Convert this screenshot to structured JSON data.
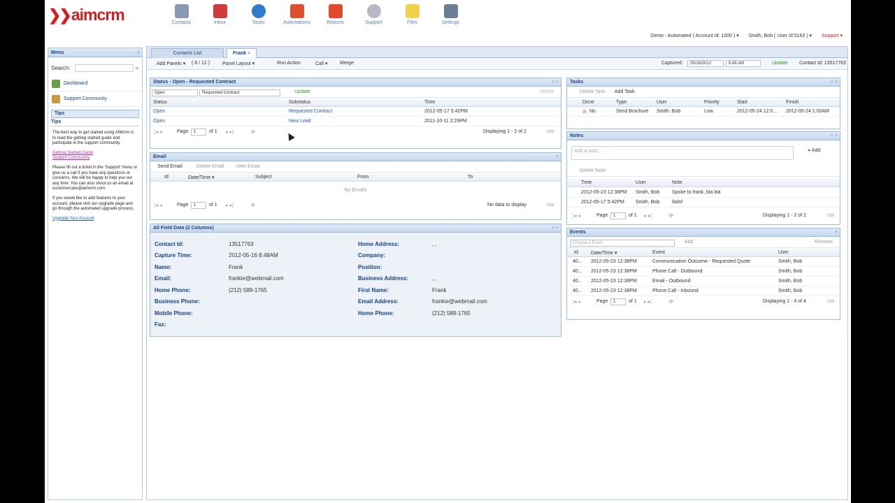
{
  "logo": {
    "mark": "❯❯",
    "text": "aimcrm"
  },
  "topnav": [
    {
      "label": "Contacts",
      "color": "#8a99b0"
    },
    {
      "label": "Inbox",
      "color": "#d33b3b"
    },
    {
      "label": "Tasks",
      "color": "#2f7cc8"
    },
    {
      "label": "Automations",
      "color": "#e0502f"
    },
    {
      "label": "Reports",
      "color": "#e04a2a"
    },
    {
      "label": "Support",
      "color": "#b8b8c4"
    },
    {
      "label": "Files",
      "color": "#f2d24a"
    },
    {
      "label": "Settings",
      "color": "#6c7f96"
    }
  ],
  "userbar": {
    "account": "Demo - Automated ( Account Id: 1000 ) ▾",
    "user": "Smith, Bob ( User Id:5163 ) ▾",
    "support": "Support ▾"
  },
  "menu": {
    "title": "Menu",
    "search_label": "Search:",
    "items": [
      "Dashboard",
      "Support Community"
    ],
    "tips_tab": "Tips",
    "tips_heading": "Tips",
    "tips_p1": "The best way to get started using AIMcrm is to read the getting started guide and participate in the support community.",
    "link1": "Getting Started Guide",
    "link2": "Support Community",
    "tips_p2": "Please fill out a ticket in the 'Support' menu or give us a call if you have any questions or concerns. We will be happy to help you out any time. You can also shoot us an email at customercare@aimcrm.com.",
    "tips_p3": "If you would like to add features to your account, please visit our upgrade page and go through the automated upgrade process.",
    "link3": "Upgrade Your Account"
  },
  "tabs": [
    "Contacts List",
    "Frank"
  ],
  "toolbar": {
    "add_panels": "Add Panels ▾",
    "panel_count": "( 8 / 12 )",
    "panel_layout": "Panel Layout ▾",
    "run_action": "Run Action",
    "call": "Call ▾",
    "merge": "Merge",
    "captured_label": "Captured:",
    "captured_date": "05/16/2012",
    "captured_time": "8:48 AM",
    "update": "Update",
    "contact_id": "Contact Id: 13517763"
  },
  "status_panel": {
    "title": "Status - Open - Requested Contract",
    "status_select": "Open",
    "substatus_select": "Requested Contract",
    "update": "Update",
    "delete": "Delete",
    "cols": [
      "Status",
      "Substatus",
      "Time"
    ],
    "rows": [
      {
        "status": "Open",
        "substatus": "Requested Contract",
        "time": "2012-05-17 5:42PM"
      },
      {
        "status": "Open",
        "substatus": "New Lead",
        "time": "2011-10-11 2:29PM"
      }
    ],
    "page_label": "Page",
    "page_num": "1",
    "page_of": "of 1",
    "displaying": "Displaying 1 - 2 of 2",
    "csv": "csv"
  },
  "email_panel": {
    "title": "Email",
    "send": "Send Email",
    "delete": "Delete Email",
    "view": "View Email",
    "cols": [
      "Id",
      "Date/Time ▾",
      "Subject",
      "From",
      "To"
    ],
    "empty": "No Emails",
    "page_label": "Page",
    "page_num": "1",
    "page_of": "of 1",
    "displaying": "No data to display",
    "csv": "csv"
  },
  "fields_panel": {
    "title": "All Field Data (2 Columns)",
    "left": [
      {
        "label": "Contact Id:",
        "value": "13517763"
      },
      {
        "label": "Capture Time:",
        "value": "2012-05-16 8:48AM"
      },
      {
        "label": "Name:",
        "value": "Frank"
      },
      {
        "label": "Email:",
        "value": "frankie@webmail.com"
      },
      {
        "label": "Home Phone:",
        "value": "(212) 589-1765"
      },
      {
        "label": "Business Phone:",
        "value": ""
      },
      {
        "label": "Mobile Phone:",
        "value": ""
      },
      {
        "label": "Fax:",
        "value": ""
      }
    ],
    "right": [
      {
        "label": "Home Address:",
        "value": ", ,"
      },
      {
        "label": "Company:",
        "value": ""
      },
      {
        "label": "Position:",
        "value": ""
      },
      {
        "label": "Business Address:",
        "value": ", ,"
      },
      {
        "label": "First Name:",
        "value": "Frank"
      },
      {
        "label": "Email Address:",
        "value": "frankie@webmail.com"
      },
      {
        "label": "Home Phone:",
        "value": "(212) 589-1765"
      }
    ]
  },
  "tasks_panel": {
    "title": "Tasks",
    "delete": "Delete Task",
    "add": "Add Task",
    "cols": [
      "Done",
      "Type",
      "User",
      "Priority",
      "Start",
      "Finish"
    ],
    "row": {
      "done": "No",
      "type": "Send Brochure",
      "user": "Smith, Bob",
      "priority": "Low",
      "start": "2012-05-24 12:0...",
      "finish": "2012-05-24 1:00AM"
    }
  },
  "notes_panel": {
    "title": "Notes",
    "placeholder": "Add a note...",
    "add": "Add",
    "delete": "Delete Note",
    "cols": [
      "Time",
      "User",
      "Note"
    ],
    "rows": [
      {
        "time": "2012-05-23 12:38PM",
        "user": "Smith, Bob",
        "note": "Spoke to frank, bla bla"
      },
      {
        "time": "2012-05-17 5:42PM",
        "user": "Smith, Bob",
        "note": "fadsf"
      }
    ],
    "page_label": "Page",
    "page_num": "1",
    "page_of": "of 1",
    "displaying": "Displaying 1 - 2 of 2",
    "csv": "csv"
  },
  "events_panel": {
    "title": "Events",
    "choose": "Choose a Event",
    "add": "Add",
    "remove": "Remove",
    "cols": [
      "Id",
      "Date/Time ▾",
      "Event",
      "User"
    ],
    "rows": [
      {
        "id": "40...",
        "time": "2012-05-23 12:38PM",
        "event": "Communication Outcome - Requested Quote",
        "user": "Smith, Bob"
      },
      {
        "id": "40...",
        "time": "2012-05-23 12:38PM",
        "event": "Phone Call - Outbound",
        "user": "Smith, Bob"
      },
      {
        "id": "40...",
        "time": "2012-05-23 12:38PM",
        "event": "Email - Outbound",
        "user": "Smith, Bob"
      },
      {
        "id": "40...",
        "time": "2012-05-23 12:38PM",
        "event": "Phone Call - Inbound",
        "user": "Smith, Bob"
      }
    ],
    "page_label": "Page",
    "page_num": "1",
    "page_of": "of 1",
    "displaying": "Displaying 1 - 4 of 4",
    "csv": "csv"
  }
}
